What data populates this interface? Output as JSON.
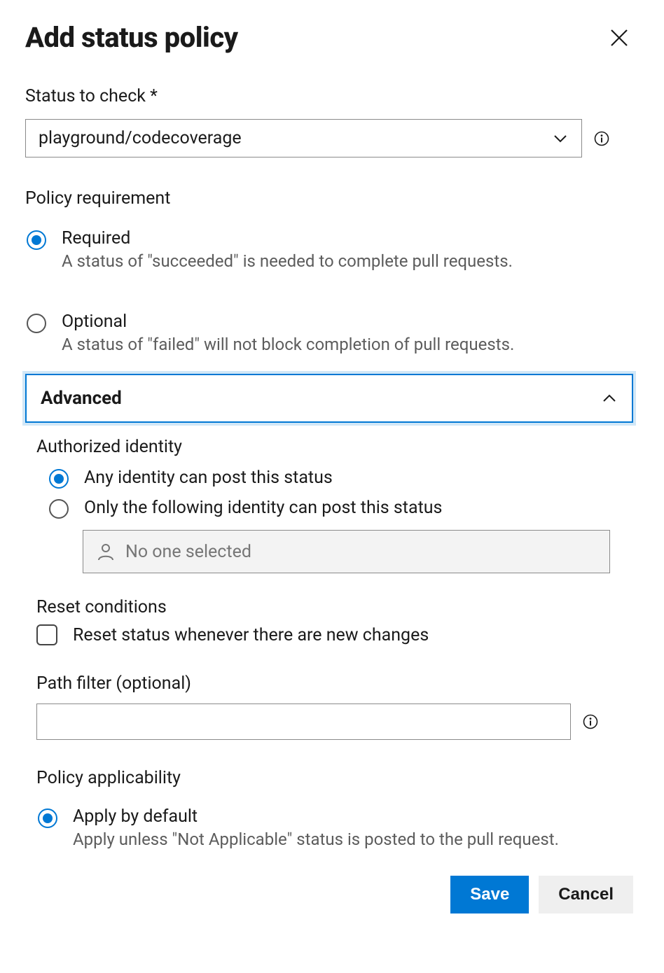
{
  "header": {
    "title": "Add status policy"
  },
  "status": {
    "label": "Status to check *",
    "value": "playground/codecoverage"
  },
  "policy_requirement": {
    "label": "Policy requirement",
    "options": {
      "required": {
        "label": "Required",
        "desc": "A status of \"succeeded\" is needed to complete pull requests.",
        "selected": true
      },
      "optional": {
        "label": "Optional",
        "desc": "A status of \"failed\" will not block completion of pull requests.",
        "selected": false
      }
    }
  },
  "advanced": {
    "label": "Advanced",
    "expanded": true,
    "authorized_identity": {
      "label": "Authorized identity",
      "any": {
        "label": "Any identity can post this status",
        "selected": true
      },
      "only": {
        "label": "Only the following identity can post this status",
        "selected": false
      },
      "identity_placeholder": "No one selected",
      "identity_value": ""
    },
    "reset_conditions": {
      "label": "Reset conditions",
      "reset_on_change": {
        "label": "Reset status whenever there are new changes",
        "checked": false
      }
    },
    "path_filter": {
      "label": "Path filter (optional)",
      "value": ""
    },
    "policy_applicability": {
      "label": "Policy applicability",
      "apply_default": {
        "label": "Apply by default",
        "desc": "Apply unless \"Not Applicable\" status is posted to the pull request.",
        "selected": true
      }
    }
  },
  "footer": {
    "save": "Save",
    "cancel": "Cancel"
  }
}
